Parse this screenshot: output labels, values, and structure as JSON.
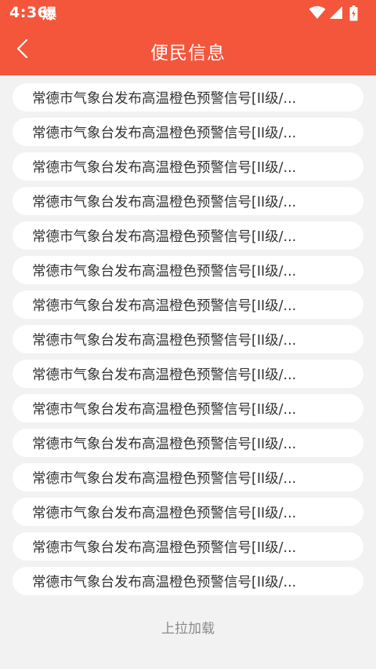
{
  "status_bar": {
    "time": "4:36",
    "app_icon": "爆",
    "icons": [
      "wifi-icon",
      "cellular-signal-icon",
      "battery-charging-icon"
    ]
  },
  "colors": {
    "header": "#f3563a",
    "background": "#f2f2f2",
    "item_background": "#ffffff",
    "item_text": "#333333",
    "footer_text": "#8a8a8a"
  },
  "nav": {
    "back_icon": "chevron-left-icon",
    "title": "便民信息"
  },
  "items": [
    {
      "title": "常德市气象台发布高温橙色预警信号[II级/..."
    },
    {
      "title": "常德市气象台发布高温橙色预警信号[II级/..."
    },
    {
      "title": "常德市气象台发布高温橙色预警信号[II级/..."
    },
    {
      "title": "常德市气象台发布高温橙色预警信号[II级/..."
    },
    {
      "title": "常德市气象台发布高温橙色预警信号[II级/..."
    },
    {
      "title": "常德市气象台发布高温橙色预警信号[II级/..."
    },
    {
      "title": "常德市气象台发布高温橙色预警信号[II级/..."
    },
    {
      "title": "常德市气象台发布高温橙色预警信号[II级/..."
    },
    {
      "title": "常德市气象台发布高温橙色预警信号[II级/..."
    },
    {
      "title": "常德市气象台发布高温橙色预警信号[II级/..."
    },
    {
      "title": "常德市气象台发布高温橙色预警信号[II级/..."
    },
    {
      "title": "常德市气象台发布高温橙色预警信号[II级/..."
    },
    {
      "title": "常德市气象台发布高温橙色预警信号[II级/..."
    },
    {
      "title": "常德市气象台发布高温橙色预警信号[II级/..."
    },
    {
      "title": "常德市气象台发布高温橙色预警信号[II级/..."
    }
  ],
  "footer": {
    "load_more": "上拉加载"
  }
}
